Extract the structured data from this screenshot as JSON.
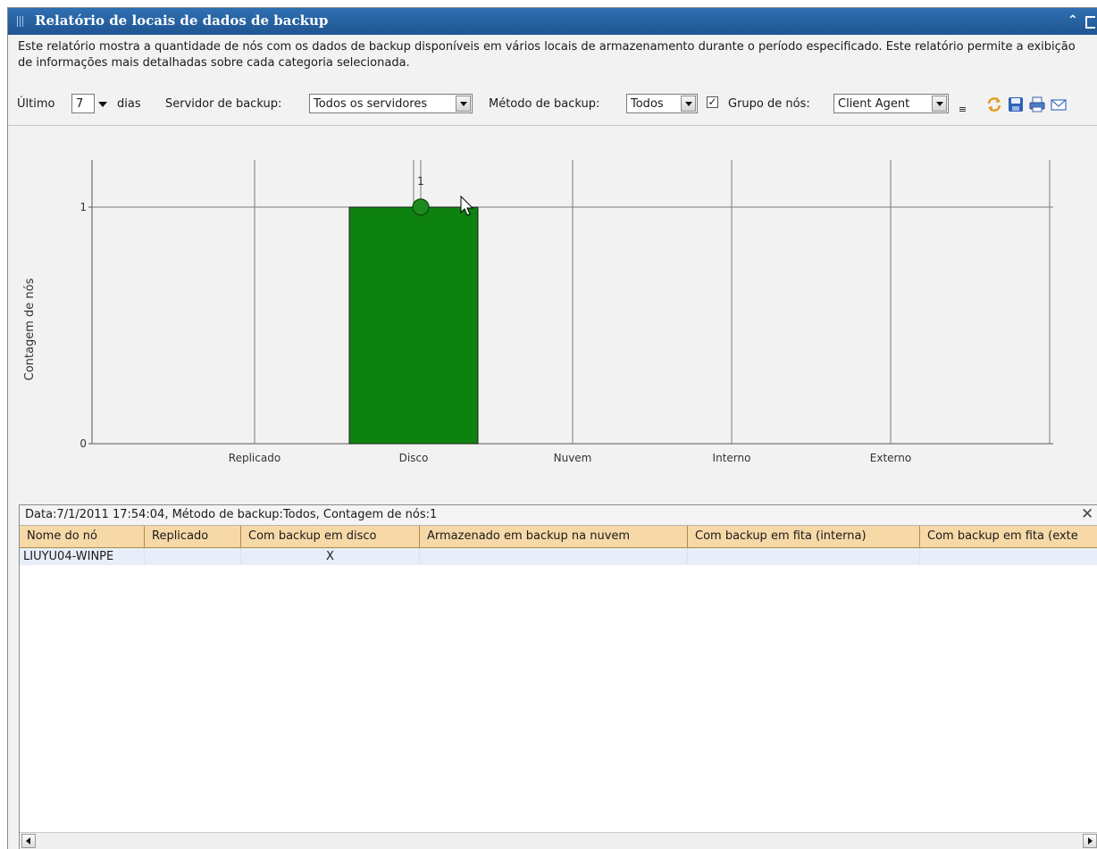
{
  "window": {
    "title": "Relatório de locais de dados de backup"
  },
  "description": "Este relatório mostra a quantidade de nós com os dados de backup disponíveis em vários locais de armazenamento durante o período especificado. Este relatório permite a exibição de informações mais detalhadas sobre cada categoria selecionada.",
  "filters": {
    "last_label": "Último",
    "days_value": "7",
    "days_label": "dias",
    "server_label": "Servidor de backup:",
    "server_value": "Todos os servidores",
    "method_label": "Método de backup:",
    "method_value": "Todos",
    "node_group_checked": true,
    "node_group_label": "Grupo de nós:",
    "node_group_value": "Client Agent"
  },
  "toolbar_icons": [
    "options-icon",
    "refresh-icon",
    "save-icon",
    "print-icon",
    "email-icon"
  ],
  "colors": {
    "title_bar": "#1f5591",
    "bar_fill": "#0e820e",
    "header_bg": "#f7d9a8",
    "selected_row": "#e8eef9"
  },
  "chart_data": {
    "type": "bar",
    "categories": [
      "Replicado",
      "Disco",
      "Nuvem",
      "Interno",
      "Externo"
    ],
    "values": [
      0,
      1,
      0,
      0,
      0
    ],
    "ylabel": "Contagem de nós",
    "xlabel": "",
    "yticks": [
      "0",
      "1"
    ],
    "ylim": [
      0,
      1.2
    ],
    "data_labels": [
      "",
      "1",
      "",
      "",
      ""
    ],
    "highlighted_category": "Disco",
    "grid": true
  },
  "detail": {
    "caption": "Data:7/1/2011 17:54:04, Método de backup:Todos, Contagem de nós:1",
    "columns": [
      "Nome do nó",
      "Replicado",
      "Com backup em disco",
      "Armazenado em backup na nuvem",
      "Com backup em fita (interna)",
      "Com backup em fita (exte"
    ],
    "rows": [
      [
        "LIUYU04-WINPE",
        "",
        "X",
        "",
        "",
        ""
      ]
    ]
  }
}
